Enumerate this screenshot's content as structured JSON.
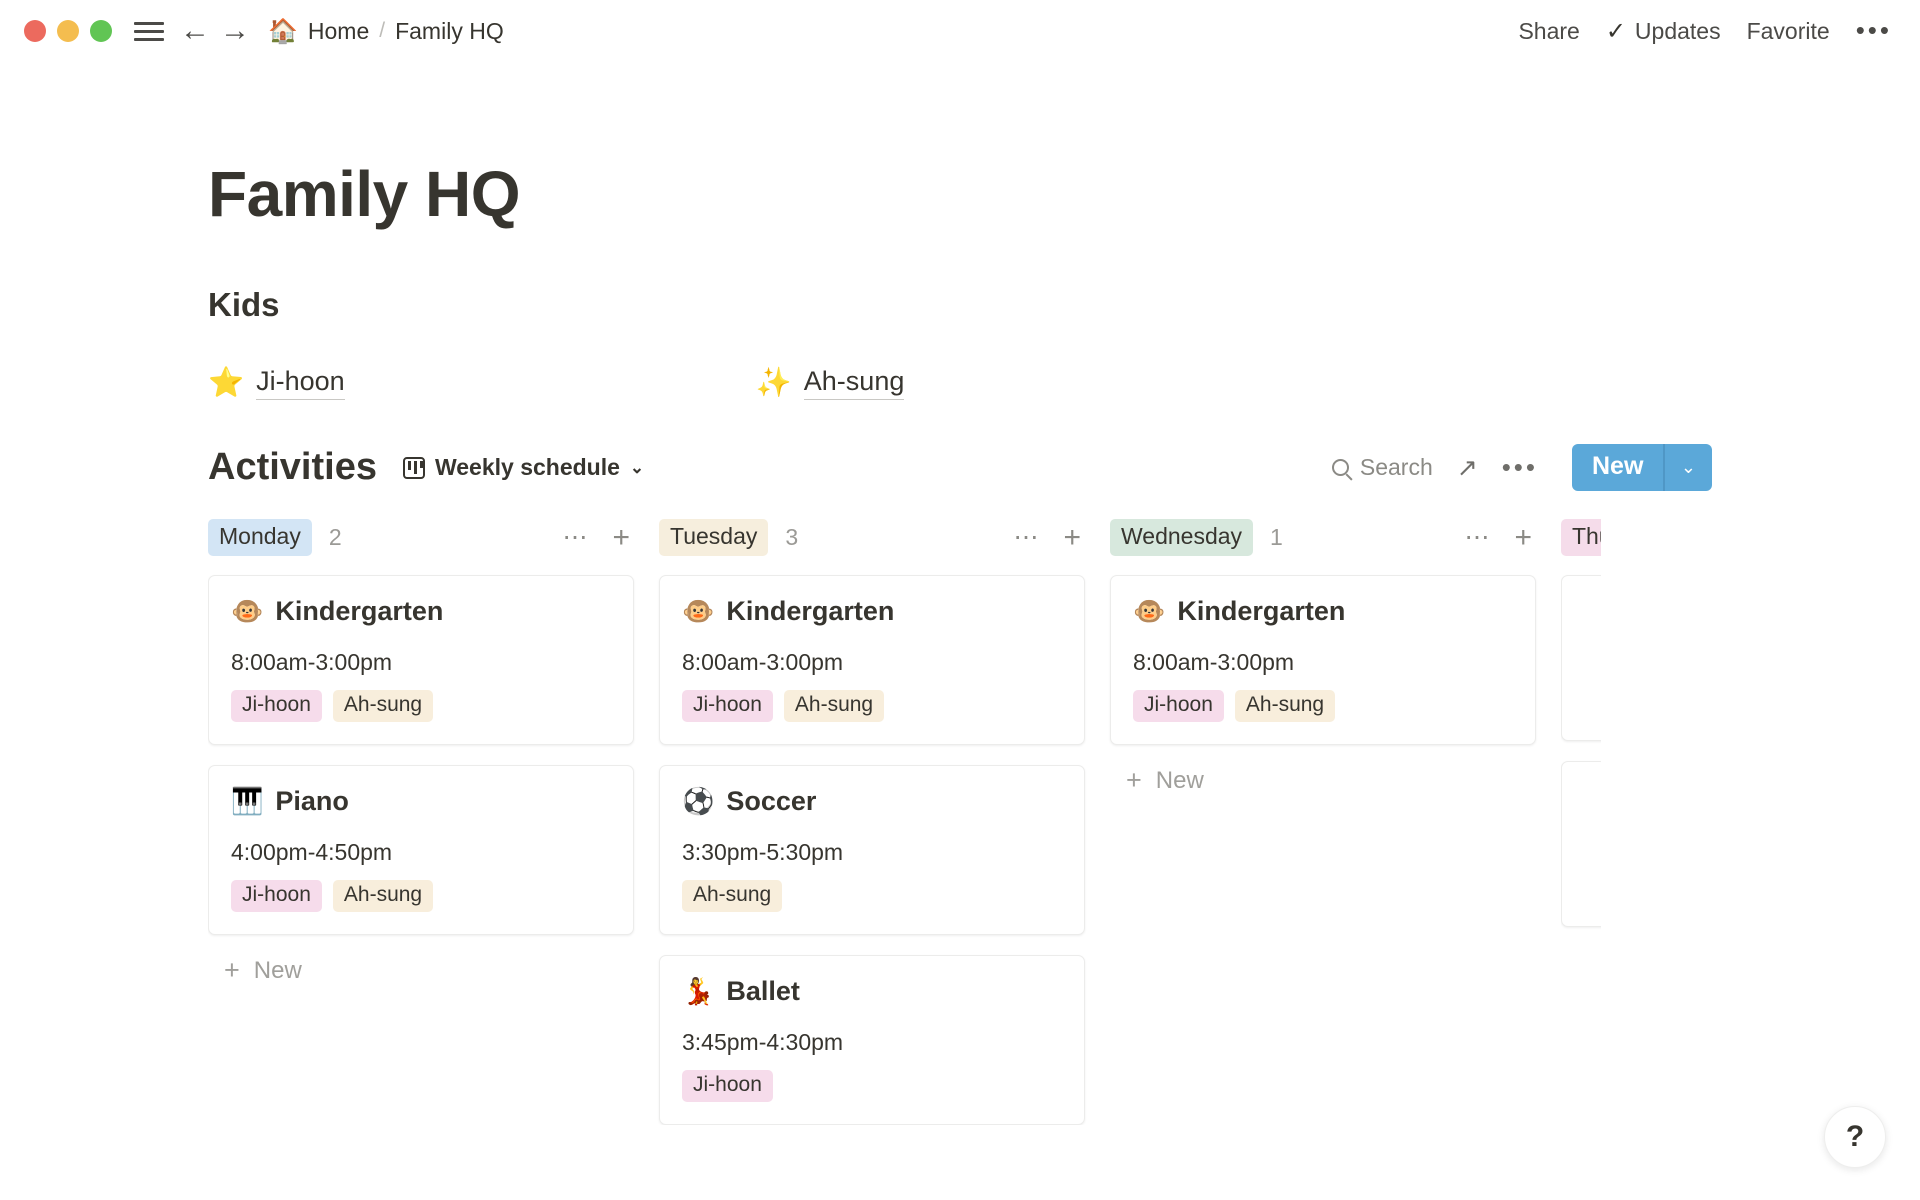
{
  "titlebar": {
    "window_controls": [
      "close",
      "minimize",
      "maximize"
    ],
    "menu_icon": "hamburger-icon",
    "back_label": "←",
    "forward_label": "→",
    "breadcrumb": {
      "home_emoji": "🏠",
      "home_label": "Home",
      "separator": "/",
      "current_label": "Family HQ"
    },
    "share_label": "Share",
    "updates_check": "✓",
    "updates_label": "Updates",
    "favorite_label": "Favorite",
    "more_label": "•••"
  },
  "page": {
    "title": "Family HQ",
    "kids_heading": "Kids",
    "kids": [
      {
        "emoji": "⭐",
        "name": "Ji-hoon"
      },
      {
        "emoji": "✨",
        "name": "Ah-sung"
      }
    ]
  },
  "database": {
    "title": "Activities",
    "view_icon": "board-view-icon",
    "view_label": "Weekly schedule",
    "view_caret": "⌄",
    "search_label": "Search",
    "expand_icon": "↗",
    "more_icon": "•••",
    "new_label": "New",
    "new_caret": "⌄",
    "accent_color": "#5ba8d9"
  },
  "board": {
    "columns": [
      {
        "name": "Monday",
        "chip_color": "blue",
        "count": "2",
        "new_label": "New",
        "show_new": true,
        "cards": [
          {
            "emoji": "🐵",
            "title": "Kindergarten",
            "time": "8:00am-3:00pm",
            "tags": [
              {
                "label": "Ji-hoon",
                "color": "pink"
              },
              {
                "label": "Ah-sung",
                "color": "cream"
              }
            ]
          },
          {
            "emoji": "🎹",
            "title": "Piano",
            "time": "4:00pm-4:50pm",
            "tags": [
              {
                "label": "Ji-hoon",
                "color": "pink"
              },
              {
                "label": "Ah-sung",
                "color": "cream"
              }
            ]
          }
        ]
      },
      {
        "name": "Tuesday",
        "chip_color": "cream",
        "count": "3",
        "new_label": "New",
        "show_new": false,
        "cards": [
          {
            "emoji": "🐵",
            "title": "Kindergarten",
            "time": "8:00am-3:00pm",
            "tags": [
              {
                "label": "Ji-hoon",
                "color": "pink"
              },
              {
                "label": "Ah-sung",
                "color": "cream"
              }
            ]
          },
          {
            "emoji": "⚽",
            "title": "Soccer",
            "time": "3:30pm-5:30pm",
            "tags": [
              {
                "label": "Ah-sung",
                "color": "cream"
              }
            ]
          },
          {
            "emoji": "💃",
            "title": "Ballet",
            "time": "3:45pm-4:30pm",
            "tags": [
              {
                "label": "Ji-hoon",
                "color": "pink"
              }
            ]
          }
        ]
      },
      {
        "name": "Wednesday",
        "chip_color": "green",
        "count": "1",
        "new_label": "New",
        "show_new": true,
        "cards": [
          {
            "emoji": "🐵",
            "title": "Kindergarten",
            "time": "8:00am-3:00pm",
            "tags": [
              {
                "label": "Ji-hoon",
                "color": "pink"
              },
              {
                "label": "Ah-sung",
                "color": "cream"
              }
            ]
          }
        ]
      },
      {
        "name": "Thursday",
        "chip_color": "pink",
        "count": "",
        "new_label": "New",
        "show_new": false,
        "partial": true,
        "cards": [
          {
            "emoji": "",
            "title": "",
            "time": "",
            "tags": []
          },
          {
            "emoji": "",
            "title": "",
            "time": "",
            "tags": []
          }
        ]
      }
    ]
  },
  "help": {
    "label": "?"
  }
}
